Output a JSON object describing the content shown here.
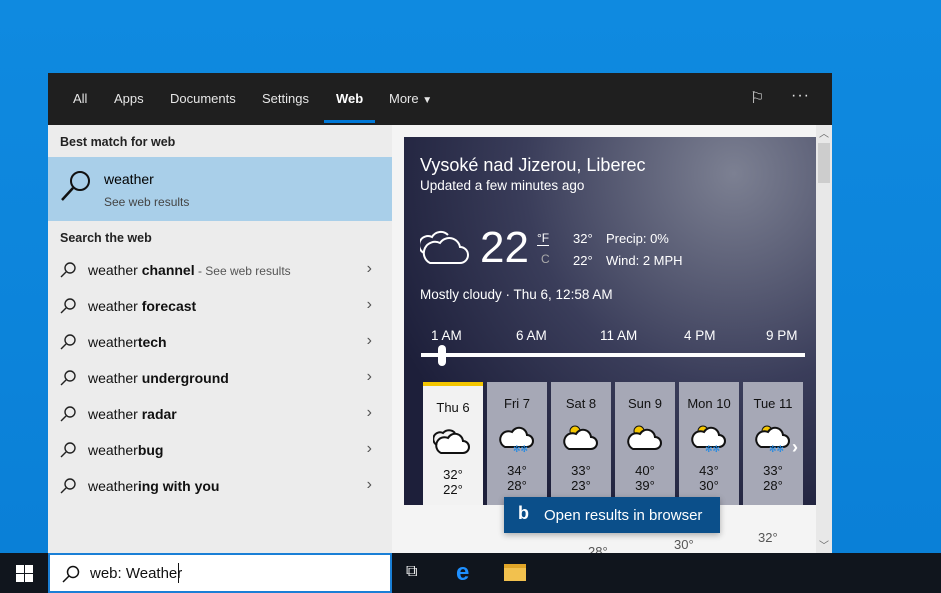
{
  "tabs": [
    "All",
    "Apps",
    "Documents",
    "Settings",
    "Web",
    "More"
  ],
  "active_tab": "Web",
  "left": {
    "best_match_header": "Best match for web",
    "best_match": {
      "title": "weather",
      "subtitle": "See web results"
    },
    "search_web_header": "Search the web",
    "suggestions": [
      {
        "prefix": "weather ",
        "bold": "channel",
        "suffix": " - See web results"
      },
      {
        "prefix": "weather ",
        "bold": "forecast",
        "suffix": ""
      },
      {
        "prefix": "weather",
        "bold": "tech",
        "suffix": ""
      },
      {
        "prefix": "weather ",
        "bold": "underground",
        "suffix": ""
      },
      {
        "prefix": "weather ",
        "bold": "radar",
        "suffix": ""
      },
      {
        "prefix": "weather",
        "bold": "bug",
        "suffix": ""
      },
      {
        "prefix": "weather",
        "bold": "ing with you",
        "suffix": ""
      }
    ]
  },
  "weather": {
    "location": "Vysoké nad Jizerou, Liberec",
    "updated": "Updated a few minutes ago",
    "temp": "22",
    "unit_f": "°F",
    "unit_c": "C",
    "high": "32°",
    "low": "22°",
    "precip": "Precip: 0%",
    "wind": "Wind: 2 MPH",
    "condition": "Mostly cloudy · Thu 6, 12:58 AM",
    "hours": [
      "1 AM",
      "6 AM",
      "11 AM",
      "4 PM",
      "9 PM"
    ],
    "slider_position": 0,
    "days": [
      {
        "name": "Thu 6",
        "icon": "cloudy-icon",
        "hi": "32°",
        "lo": "22°"
      },
      {
        "name": "Fri 7",
        "icon": "snow-cloud-icon",
        "hi": "34°",
        "lo": "28°"
      },
      {
        "name": "Sat 8",
        "icon": "partly-sunny-icon",
        "hi": "33°",
        "lo": "23°"
      },
      {
        "name": "Sun 9",
        "icon": "partly-sunny-icon",
        "hi": "40°",
        "lo": "39°"
      },
      {
        "name": "Mon 10",
        "icon": "sun-snow-icon",
        "hi": "43°",
        "lo": "30°"
      },
      {
        "name": "Tue 11",
        "icon": "sun-snow-icon",
        "hi": "33°",
        "lo": "28°"
      }
    ],
    "below": [
      "28°",
      "30°",
      "32°"
    ]
  },
  "open_browser": "Open results in browser",
  "search_value": "web: Weather",
  "accent": "#0078d7"
}
